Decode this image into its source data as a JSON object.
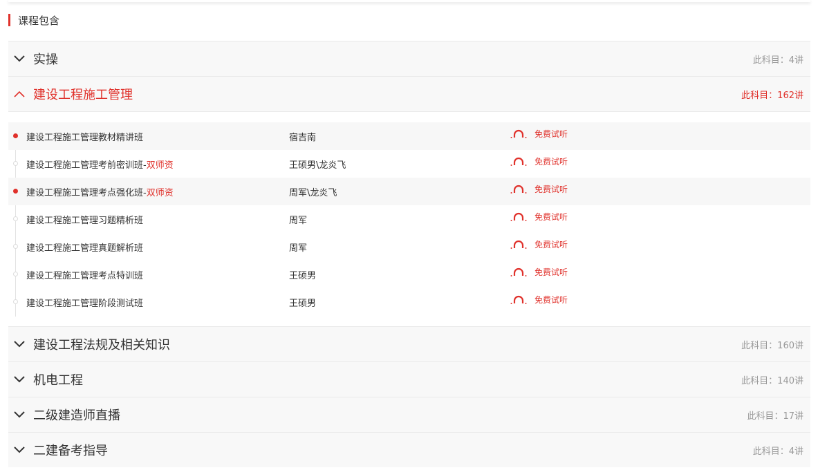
{
  "section": {
    "title": "课程包含"
  },
  "accent": "#e0312b",
  "subjects": [
    {
      "title": "实操",
      "count": "此科目：4讲",
      "open": false
    },
    {
      "title": "建设工程施工管理",
      "count": "此科目：162讲",
      "open": true,
      "lessons": [
        {
          "name": "建设工程施工管理教材精讲班",
          "tag": "",
          "teacher": "宿吉南",
          "listen": "免费试听",
          "active": true
        },
        {
          "name": "建设工程施工管理考前密训班-",
          "tag": "双师资",
          "teacher": "王硕男\\龙炎飞",
          "listen": "免费试听",
          "active": false
        },
        {
          "name": "建设工程施工管理考点强化班-",
          "tag": "双师资",
          "teacher": "周军\\龙炎飞",
          "listen": "免费试听",
          "active": true
        },
        {
          "name": "建设工程施工管理习题精析班",
          "tag": "",
          "teacher": "周军",
          "listen": "免费试听",
          "active": false
        },
        {
          "name": "建设工程施工管理真题解析班",
          "tag": "",
          "teacher": "周军",
          "listen": "免费试听",
          "active": false
        },
        {
          "name": "建设工程施工管理考点特训班",
          "tag": "",
          "teacher": "王硕男",
          "listen": "免费试听",
          "active": false
        },
        {
          "name": "建设工程施工管理阶段测试班",
          "tag": "",
          "teacher": "王硕男",
          "listen": "免费试听",
          "active": false
        }
      ]
    },
    {
      "title": "建设工程法规及相关知识",
      "count": "此科目：160讲",
      "open": false
    },
    {
      "title": "机电工程",
      "count": "此科目：140讲",
      "open": false
    },
    {
      "title": "二级建造师直播",
      "count": "此科目：17讲",
      "open": false
    },
    {
      "title": "二建备考指导",
      "count": "此科目：4讲",
      "open": false
    }
  ]
}
